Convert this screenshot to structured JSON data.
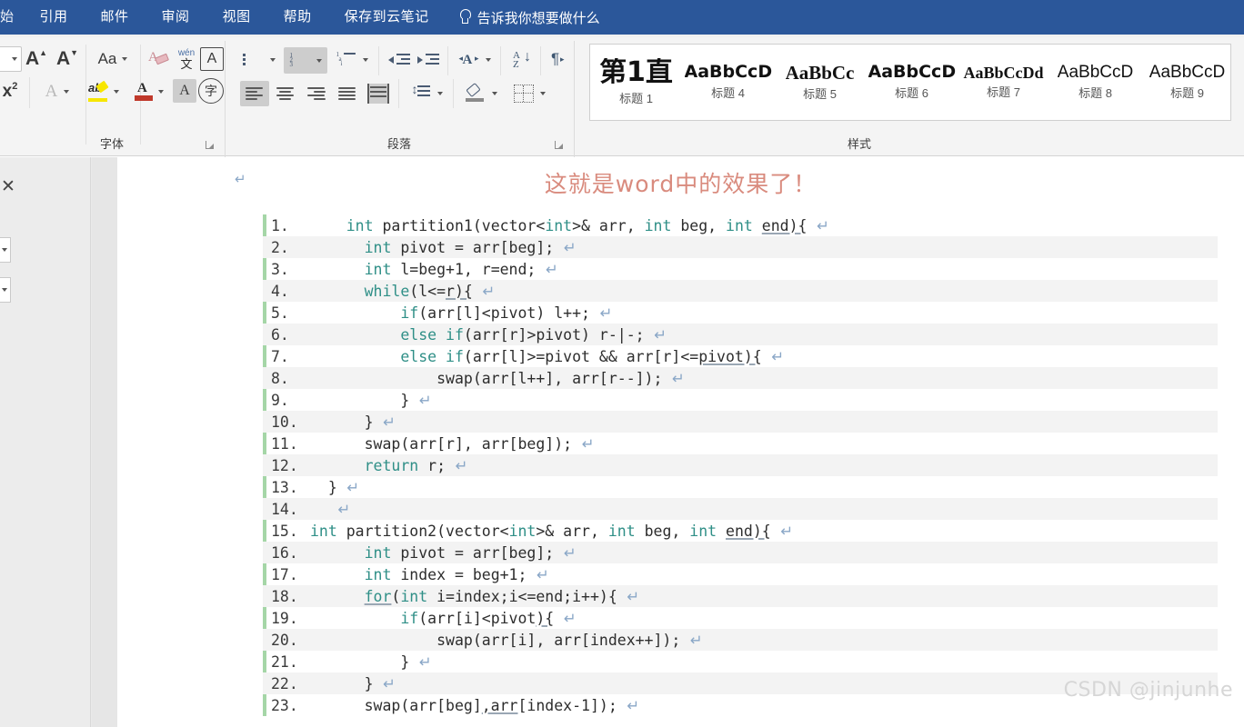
{
  "ribbon": {
    "tabs": [
      {
        "label": "始",
        "cut": true
      },
      {
        "label": "引用",
        "cut": false
      },
      {
        "label": "邮件",
        "cut": false
      },
      {
        "label": "审阅",
        "cut": false
      },
      {
        "label": "视图",
        "cut": false
      },
      {
        "label": "帮助",
        "cut": false
      },
      {
        "label": "保存到云笔记",
        "cut": false
      }
    ],
    "tell_me": "告诉我你想要做什么",
    "tab_bar_color": "#2b579a",
    "groups": [
      {
        "label": "字体"
      },
      {
        "label": "段落"
      },
      {
        "label": "样式"
      }
    ],
    "font_group": {
      "grow_font": "A",
      "shrink_font": "A",
      "change_case": "Aa",
      "clear_formatting": "clear-formatting",
      "phonetic_guide": "wén",
      "character_border": "A",
      "superscript": "x",
      "superscript_exp": "2",
      "text_effects": "A",
      "highlight": "ab",
      "font_color": "A",
      "char_shading": "A",
      "enclose_char": "字"
    },
    "paragraph_group": {
      "bullets": "bullets",
      "numbering": "numbering",
      "multilevel": "multilevel-list",
      "decrease_indent": "decrease-indent",
      "increase_indent": "increase-indent",
      "cn_layout": "asian-layout",
      "sort": "sort",
      "show_marks": "show-formatting-marks",
      "align_left": "align-left",
      "align_center": "align-center",
      "align_right": "align-right",
      "justify": "justify",
      "distribute": "distribute",
      "line_spacing": "line-spacing",
      "shading": "shading",
      "borders": "borders",
      "sort_az_top": "A",
      "sort_az_bottom": "Z"
    },
    "styles": [
      {
        "preview": "第1直",
        "name": "标题 1",
        "font": "heading1"
      },
      {
        "preview": "AaBbCcD",
        "name": "标题 4",
        "font": "heading4"
      },
      {
        "preview": "AaBbCc",
        "name": "标题 5",
        "font": "heading5"
      },
      {
        "preview": "AaBbCcD",
        "name": "标题 6",
        "font": "heading6"
      },
      {
        "preview": "AaBbCcDd",
        "name": "标题 7",
        "font": "heading7"
      },
      {
        "preview": "AaBbCcD",
        "name": "标题 8",
        "font": "heading8"
      },
      {
        "preview": "AaBbCcD",
        "name": "标题 9",
        "font": "heading9"
      }
    ]
  },
  "document": {
    "title": "这就是word中的效果了！",
    "title_color": "#d98b7e",
    "pilcrow": "↵",
    "code_bar_color": "#a5d6a7",
    "code_lines": [
      {
        "n": "1.",
        "indent": 2,
        "tokens": [
          {
            "t": "int",
            "c": "kw"
          },
          {
            "t": " partition1(vector<",
            "c": ""
          },
          {
            "t": "int",
            "c": "kw"
          },
          {
            "t": ">& arr, ",
            "c": ""
          },
          {
            "t": "int",
            "c": "kw"
          },
          {
            "t": " beg, ",
            "c": ""
          },
          {
            "t": "int",
            "c": "kw"
          },
          {
            "t": " ",
            "c": ""
          },
          {
            "t": "end){",
            "c": "ul"
          }
        ]
      },
      {
        "n": "2.",
        "indent": 3,
        "tokens": [
          {
            "t": "int",
            "c": "kw"
          },
          {
            "t": " pivot = arr[beg];",
            "c": ""
          }
        ]
      },
      {
        "n": "3.",
        "indent": 3,
        "tokens": [
          {
            "t": "int",
            "c": "kw"
          },
          {
            "t": " l=beg+1, r=end;",
            "c": ""
          }
        ]
      },
      {
        "n": "4.",
        "indent": 3,
        "tokens": [
          {
            "t": "while",
            "c": "kw"
          },
          {
            "t": "(l<=",
            "c": ""
          },
          {
            "t": "r){",
            "c": "ul"
          }
        ]
      },
      {
        "n": "5.",
        "indent": 5,
        "tokens": [
          {
            "t": "if",
            "c": "kw"
          },
          {
            "t": "(arr[l]<pivot) l++;",
            "c": ""
          }
        ]
      },
      {
        "n": "6.",
        "indent": 5,
        "tokens": [
          {
            "t": "else",
            "c": "kw"
          },
          {
            "t": " ",
            "c": ""
          },
          {
            "t": "if",
            "c": "kw"
          },
          {
            "t": "(arr[r]>pivot) r-|-;",
            "c": ""
          }
        ]
      },
      {
        "n": "7.",
        "indent": 5,
        "tokens": [
          {
            "t": "else",
            "c": "kw"
          },
          {
            "t": " ",
            "c": ""
          },
          {
            "t": "if",
            "c": "kw"
          },
          {
            "t": "(arr[l]>=pivot && arr[r]<=",
            "c": ""
          },
          {
            "t": "pivot){",
            "c": "ul"
          }
        ]
      },
      {
        "n": "8.",
        "indent": 7,
        "tokens": [
          {
            "t": "swap(arr[l++], arr[r--]);",
            "c": ""
          }
        ]
      },
      {
        "n": "9.",
        "indent": 5,
        "tokens": [
          {
            "t": "}",
            "c": ""
          }
        ]
      },
      {
        "n": "10.",
        "indent": 3,
        "tokens": [
          {
            "t": "}",
            "c": ""
          }
        ]
      },
      {
        "n": "11.",
        "indent": 3,
        "tokens": [
          {
            "t": "swap(arr[r], arr[beg]);",
            "c": ""
          }
        ]
      },
      {
        "n": "12.",
        "indent": 3,
        "tokens": [
          {
            "t": "return",
            "c": "kw"
          },
          {
            "t": " r;",
            "c": ""
          }
        ]
      },
      {
        "n": "13.",
        "indent": 1,
        "tokens": [
          {
            "t": "}",
            "c": ""
          }
        ]
      },
      {
        "n": "14.",
        "indent": 1,
        "tokens": [
          {
            "t": "",
            "c": ""
          }
        ]
      },
      {
        "n": "15.",
        "indent": 0,
        "tokens": [
          {
            "t": "int",
            "c": "kw"
          },
          {
            "t": " partition2(vector<",
            "c": ""
          },
          {
            "t": "int",
            "c": "kw"
          },
          {
            "t": ">& arr, ",
            "c": ""
          },
          {
            "t": "int",
            "c": "kw"
          },
          {
            "t": " beg, ",
            "c": ""
          },
          {
            "t": "int",
            "c": "kw"
          },
          {
            "t": " ",
            "c": ""
          },
          {
            "t": "end){",
            "c": "ul"
          }
        ]
      },
      {
        "n": "16.",
        "indent": 3,
        "tokens": [
          {
            "t": "int",
            "c": "kw"
          },
          {
            "t": " pivot = arr[beg];",
            "c": ""
          }
        ]
      },
      {
        "n": "17.",
        "indent": 3,
        "tokens": [
          {
            "t": "int",
            "c": "kw"
          },
          {
            "t": " index = beg+1;",
            "c": ""
          }
        ]
      },
      {
        "n": "18.",
        "indent": 3,
        "tokens": [
          {
            "t": "for",
            "c": "kw ul"
          },
          {
            "t": "(",
            "c": ""
          },
          {
            "t": "int",
            "c": "kw"
          },
          {
            "t": " i=index;i<=end;i++){",
            "c": ""
          }
        ]
      },
      {
        "n": "19.",
        "indent": 5,
        "tokens": [
          {
            "t": "if",
            "c": "kw"
          },
          {
            "t": "(arr[i]<pivot",
            "c": ""
          },
          {
            "t": "){",
            "c": "ul"
          }
        ]
      },
      {
        "n": "20.",
        "indent": 7,
        "tokens": [
          {
            "t": "swap(arr[i], arr[index++]);",
            "c": ""
          }
        ]
      },
      {
        "n": "21.",
        "indent": 5,
        "tokens": [
          {
            "t": "}",
            "c": ""
          }
        ]
      },
      {
        "n": "22.",
        "indent": 3,
        "tokens": [
          {
            "t": "}",
            "c": ""
          }
        ]
      },
      {
        "n": "23.",
        "indent": 3,
        "tokens": [
          {
            "t": "swap(arr[beg]",
            "c": ""
          },
          {
            "t": ",arr",
            "c": "ul"
          },
          {
            "t": "[index-1]);",
            "c": ""
          }
        ]
      }
    ]
  },
  "watermark": "CSDN @jinjunhe"
}
